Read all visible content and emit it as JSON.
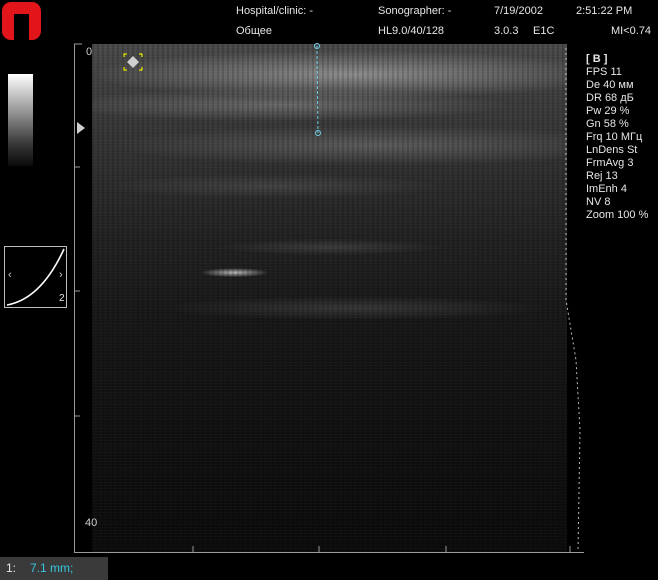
{
  "header": {
    "hospital": "Hospital/clinic: -",
    "preset": "Общее",
    "sonographer": "Sonographer: -",
    "probe": "HL9.0/40/128",
    "date": "7/19/2002",
    "version": "3.0.3",
    "mode_code": "E1C",
    "time": "2:51:22 PM",
    "mi": "MI<0.74"
  },
  "depth_scale": {
    "top_label": "0",
    "bottom_label": "40"
  },
  "gain_curve": {
    "left_arrow": "‹",
    "right_arrow": "›",
    "number": "2"
  },
  "params": {
    "mode": "[ B ]",
    "lines": [
      "FPS 11",
      "De 40 мм",
      "DR 68 дБ",
      "Pw 29 %",
      "Gn 58 %",
      "Frq 10 МГц",
      "LnDens St",
      "FrmAvg 3",
      "Rej 13",
      "ImEnh 4",
      "NV 8",
      "Zoom 100 %"
    ]
  },
  "measurement": {
    "index": "1:",
    "value": "7.1 mm;"
  },
  "colors": {
    "logo_red": "#e1151a",
    "caliper_cyan": "#6fd0e6",
    "measure_text": "#36c6e0",
    "marker_yellow": "#e6e600"
  }
}
